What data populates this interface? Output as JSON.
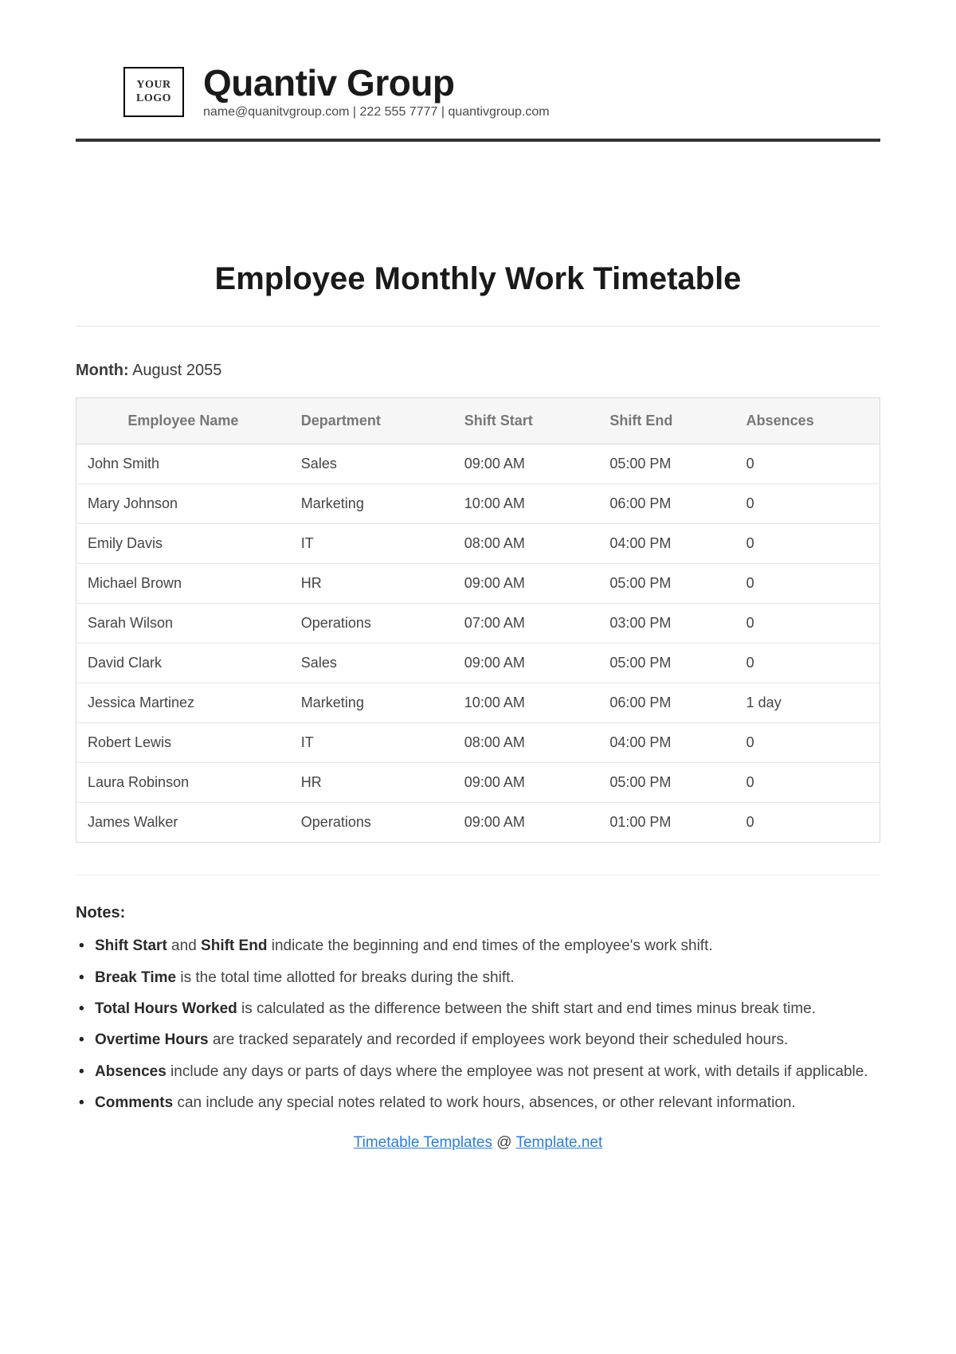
{
  "header": {
    "logo_line1": "YOUR",
    "logo_line2": "LOGO",
    "company_name": "Quantiv Group",
    "contact": "name@quanitvgroup.com | 222 555 7777 | quantivgroup.com"
  },
  "title": "Employee Monthly Work Timetable",
  "month_label": "Month:",
  "month_value": "August 2055",
  "columns": {
    "name": "Employee Name",
    "dept": "Department",
    "start": "Shift Start",
    "end": "Shift End",
    "abs": "Absences"
  },
  "rows": [
    {
      "name": "John Smith",
      "dept": "Sales",
      "start": "09:00 AM",
      "end": "05:00 PM",
      "abs": "0"
    },
    {
      "name": "Mary Johnson",
      "dept": "Marketing",
      "start": "10:00 AM",
      "end": "06:00 PM",
      "abs": "0"
    },
    {
      "name": "Emily Davis",
      "dept": "IT",
      "start": "08:00 AM",
      "end": "04:00 PM",
      "abs": "0"
    },
    {
      "name": "Michael Brown",
      "dept": "HR",
      "start": "09:00 AM",
      "end": "05:00 PM",
      "abs": "0"
    },
    {
      "name": "Sarah Wilson",
      "dept": "Operations",
      "start": "07:00 AM",
      "end": "03:00 PM",
      "abs": "0"
    },
    {
      "name": "David Clark",
      "dept": "Sales",
      "start": "09:00 AM",
      "end": "05:00 PM",
      "abs": "0"
    },
    {
      "name": "Jessica Martinez",
      "dept": "Marketing",
      "start": "10:00 AM",
      "end": "06:00 PM",
      "abs": "1 day"
    },
    {
      "name": "Robert Lewis",
      "dept": "IT",
      "start": "08:00 AM",
      "end": "04:00 PM",
      "abs": "0"
    },
    {
      "name": "Laura Robinson",
      "dept": "HR",
      "start": "09:00 AM",
      "end": "05:00 PM",
      "abs": "0"
    },
    {
      "name": "James Walker",
      "dept": "Operations",
      "start": "09:00 AM",
      "end": "01:00 PM",
      "abs": "0"
    }
  ],
  "notes_heading": "Notes:",
  "notes": [
    {
      "bold": "Shift Start",
      "mid": " and ",
      "bold2": "Shift End",
      "rest": " indicate the beginning and end times of the employee's work shift."
    },
    {
      "bold": "Break Time",
      "rest": " is the total time allotted for breaks during the shift."
    },
    {
      "bold": "Total Hours Worked",
      "rest": " is calculated as the difference between the shift start and end times minus break time."
    },
    {
      "bold": "Overtime Hours",
      "rest": " are tracked separately and recorded if employees work beyond their scheduled hours."
    },
    {
      "bold": "Absences",
      "rest": " include any days or parts of days where the employee was not present at work, with details if applicable."
    },
    {
      "bold": "Comments",
      "rest": " can include any special notes related to work hours, absences, or other relevant information."
    }
  ],
  "footer": {
    "link1_text": "Timetable Templates",
    "at": " @ ",
    "link2_text": "Template.net"
  }
}
